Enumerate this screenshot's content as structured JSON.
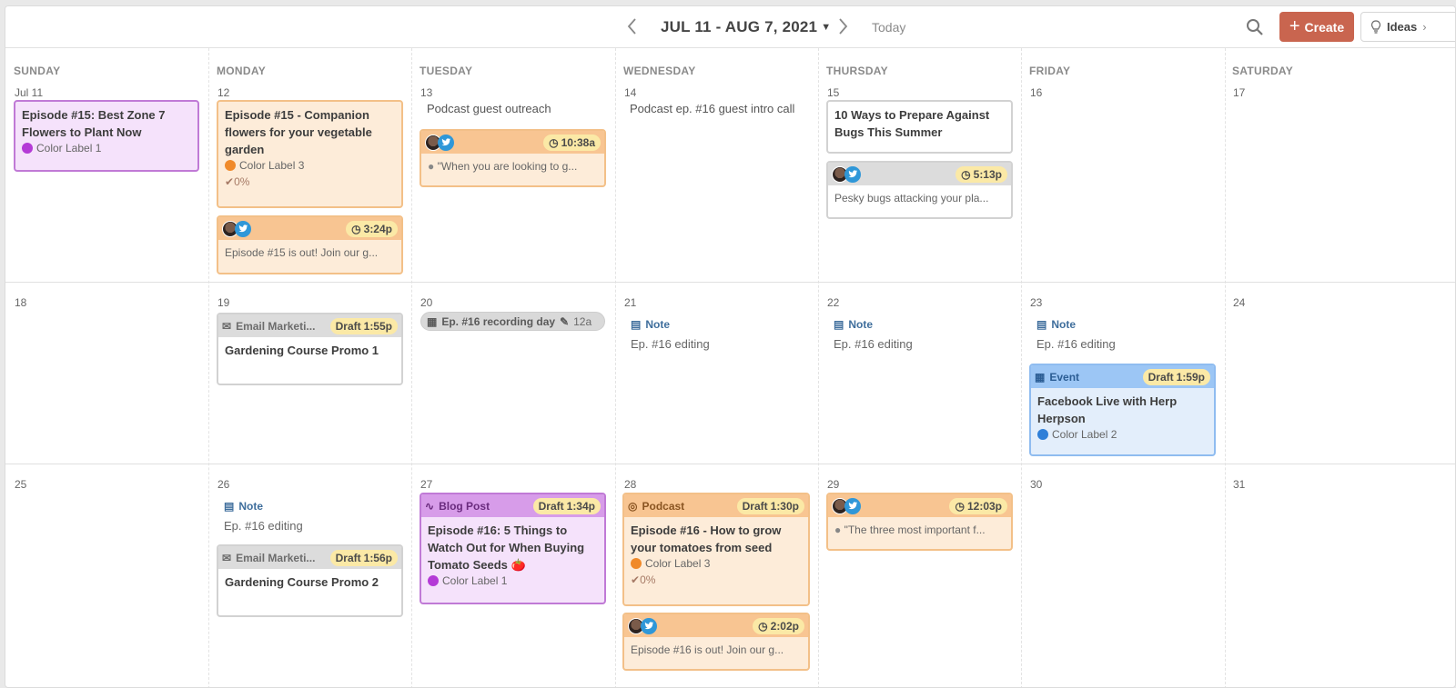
{
  "header": {
    "date_range": "JUL 11 - AUG 7, 2021",
    "today": "Today",
    "create": "Create",
    "ideas": "Ideas"
  },
  "days_of_week": [
    "SUNDAY",
    "MONDAY",
    "TUESDAY",
    "WEDNESDAY",
    "THURSDAY",
    "FRIDAY",
    "SATURDAY"
  ],
  "dates": {
    "w1": [
      "Jul 11",
      "12",
      "13",
      "14",
      "15",
      "16",
      "17"
    ],
    "w2": [
      "18",
      "19",
      "20",
      "21",
      "22",
      "23",
      "24"
    ],
    "w3": [
      "25",
      "26",
      "27",
      "28",
      "29",
      "30",
      "31"
    ]
  },
  "week1": {
    "sun_card": {
      "title": "Episode #15: Best Zone 7 Flowers to Plant Now",
      "label": "Color Label 1"
    },
    "mon_card": {
      "title": "Episode #15 - Companion flowers for your vegetable garden",
      "label": "Color Label 3",
      "progress": "0%"
    },
    "mon_social": {
      "time": "3:24p",
      "text": "Episode #15 is out! Join our g..."
    },
    "tue_plain": "Podcast guest outreach",
    "tue_social": {
      "time": "10:38a",
      "text": "\"When you are looking to g..."
    },
    "wed_plain": "Podcast ep. #16 guest intro call",
    "thu_card": {
      "title": "10 Ways to Prepare Against Bugs This Summer"
    },
    "thu_social": {
      "time": "5:13p",
      "text": "Pesky bugs attacking your pla..."
    }
  },
  "week2": {
    "mon_email": {
      "type": "Email Marketi...",
      "draft": "Draft",
      "time": "1:55p",
      "title": "Gardening Course Promo 1"
    },
    "tue_pill": {
      "title": "Ep. #16 recording day",
      "time": "12a"
    },
    "wed_note": {
      "head": "Note",
      "text": "Ep. #16 editing"
    },
    "thu_note": {
      "head": "Note",
      "text": "Ep. #16 editing"
    },
    "fri_note": {
      "head": "Note",
      "text": "Ep. #16 editing"
    },
    "fri_event": {
      "type": "Event",
      "draft": "Draft",
      "time": "1:59p",
      "title": "Facebook Live with Herp Herpson",
      "label": "Color Label 2"
    }
  },
  "week3": {
    "mon_note": {
      "head": "Note",
      "text": "Ep. #16 editing"
    },
    "mon_email": {
      "type": "Email Marketi...",
      "draft": "Draft",
      "time": "1:56p",
      "title": "Gardening Course Promo 2"
    },
    "tue_blog": {
      "type": "Blog Post",
      "draft": "Draft",
      "time": "1:34p",
      "title": "Episode #16: 5 Things to Watch Out for When Buying Tomato Seeds 🍅",
      "label": "Color Label 1"
    },
    "wed_podcast": {
      "type": "Podcast",
      "draft": "Draft",
      "time": "1:30p",
      "title": "Episode #16 - How to grow your tomatoes from seed",
      "label": "Color Label 3",
      "progress": "0%"
    },
    "wed_social": {
      "time": "2:02p",
      "text": "Episode #16 is out! Join our g..."
    },
    "thu_social": {
      "time": "12:03p",
      "text": "\"The three most important f..."
    }
  },
  "colors": {
    "label1": "#b43ad6",
    "label2": "#2f7fd8",
    "label3": "#f08a2a",
    "accent": "#c9654f"
  }
}
